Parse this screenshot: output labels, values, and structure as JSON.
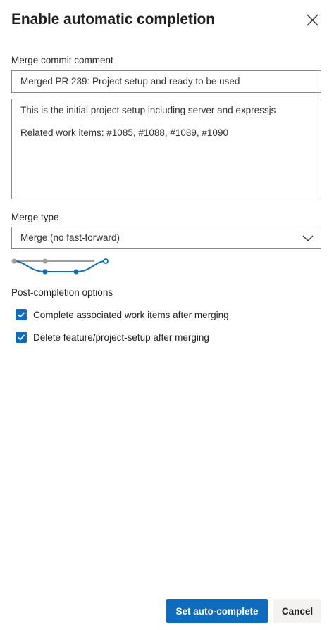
{
  "dialog": {
    "title": "Enable automatic completion",
    "close_icon": "close-icon"
  },
  "merge_commit": {
    "label": "Merge commit comment",
    "title_value": "Merged PR 239: Project setup and ready to be used",
    "description_value": "This is the initial project setup including server and expressjs\n\nRelated work items: #1085, #1088, #1089, #1090"
  },
  "merge_type": {
    "label": "Merge type",
    "selected": "Merge (no fast-forward)",
    "chevron_icon": "chevron-down-icon",
    "diagram_icon": "merge-graph-icon"
  },
  "post_completion": {
    "label": "Post-completion options",
    "options": [
      {
        "label": "Complete associated work items after merging",
        "checked": true
      },
      {
        "label": "Delete feature/project-setup after merging",
        "checked": true
      }
    ]
  },
  "footer": {
    "primary_label": "Set auto-complete",
    "cancel_label": "Cancel"
  },
  "colors": {
    "accent": "#0f6cbd",
    "border": "#8a8886",
    "text": "#201f1e",
    "secondary_button_bg": "#f3f2f1",
    "graph_gray": "#a19f9d"
  }
}
